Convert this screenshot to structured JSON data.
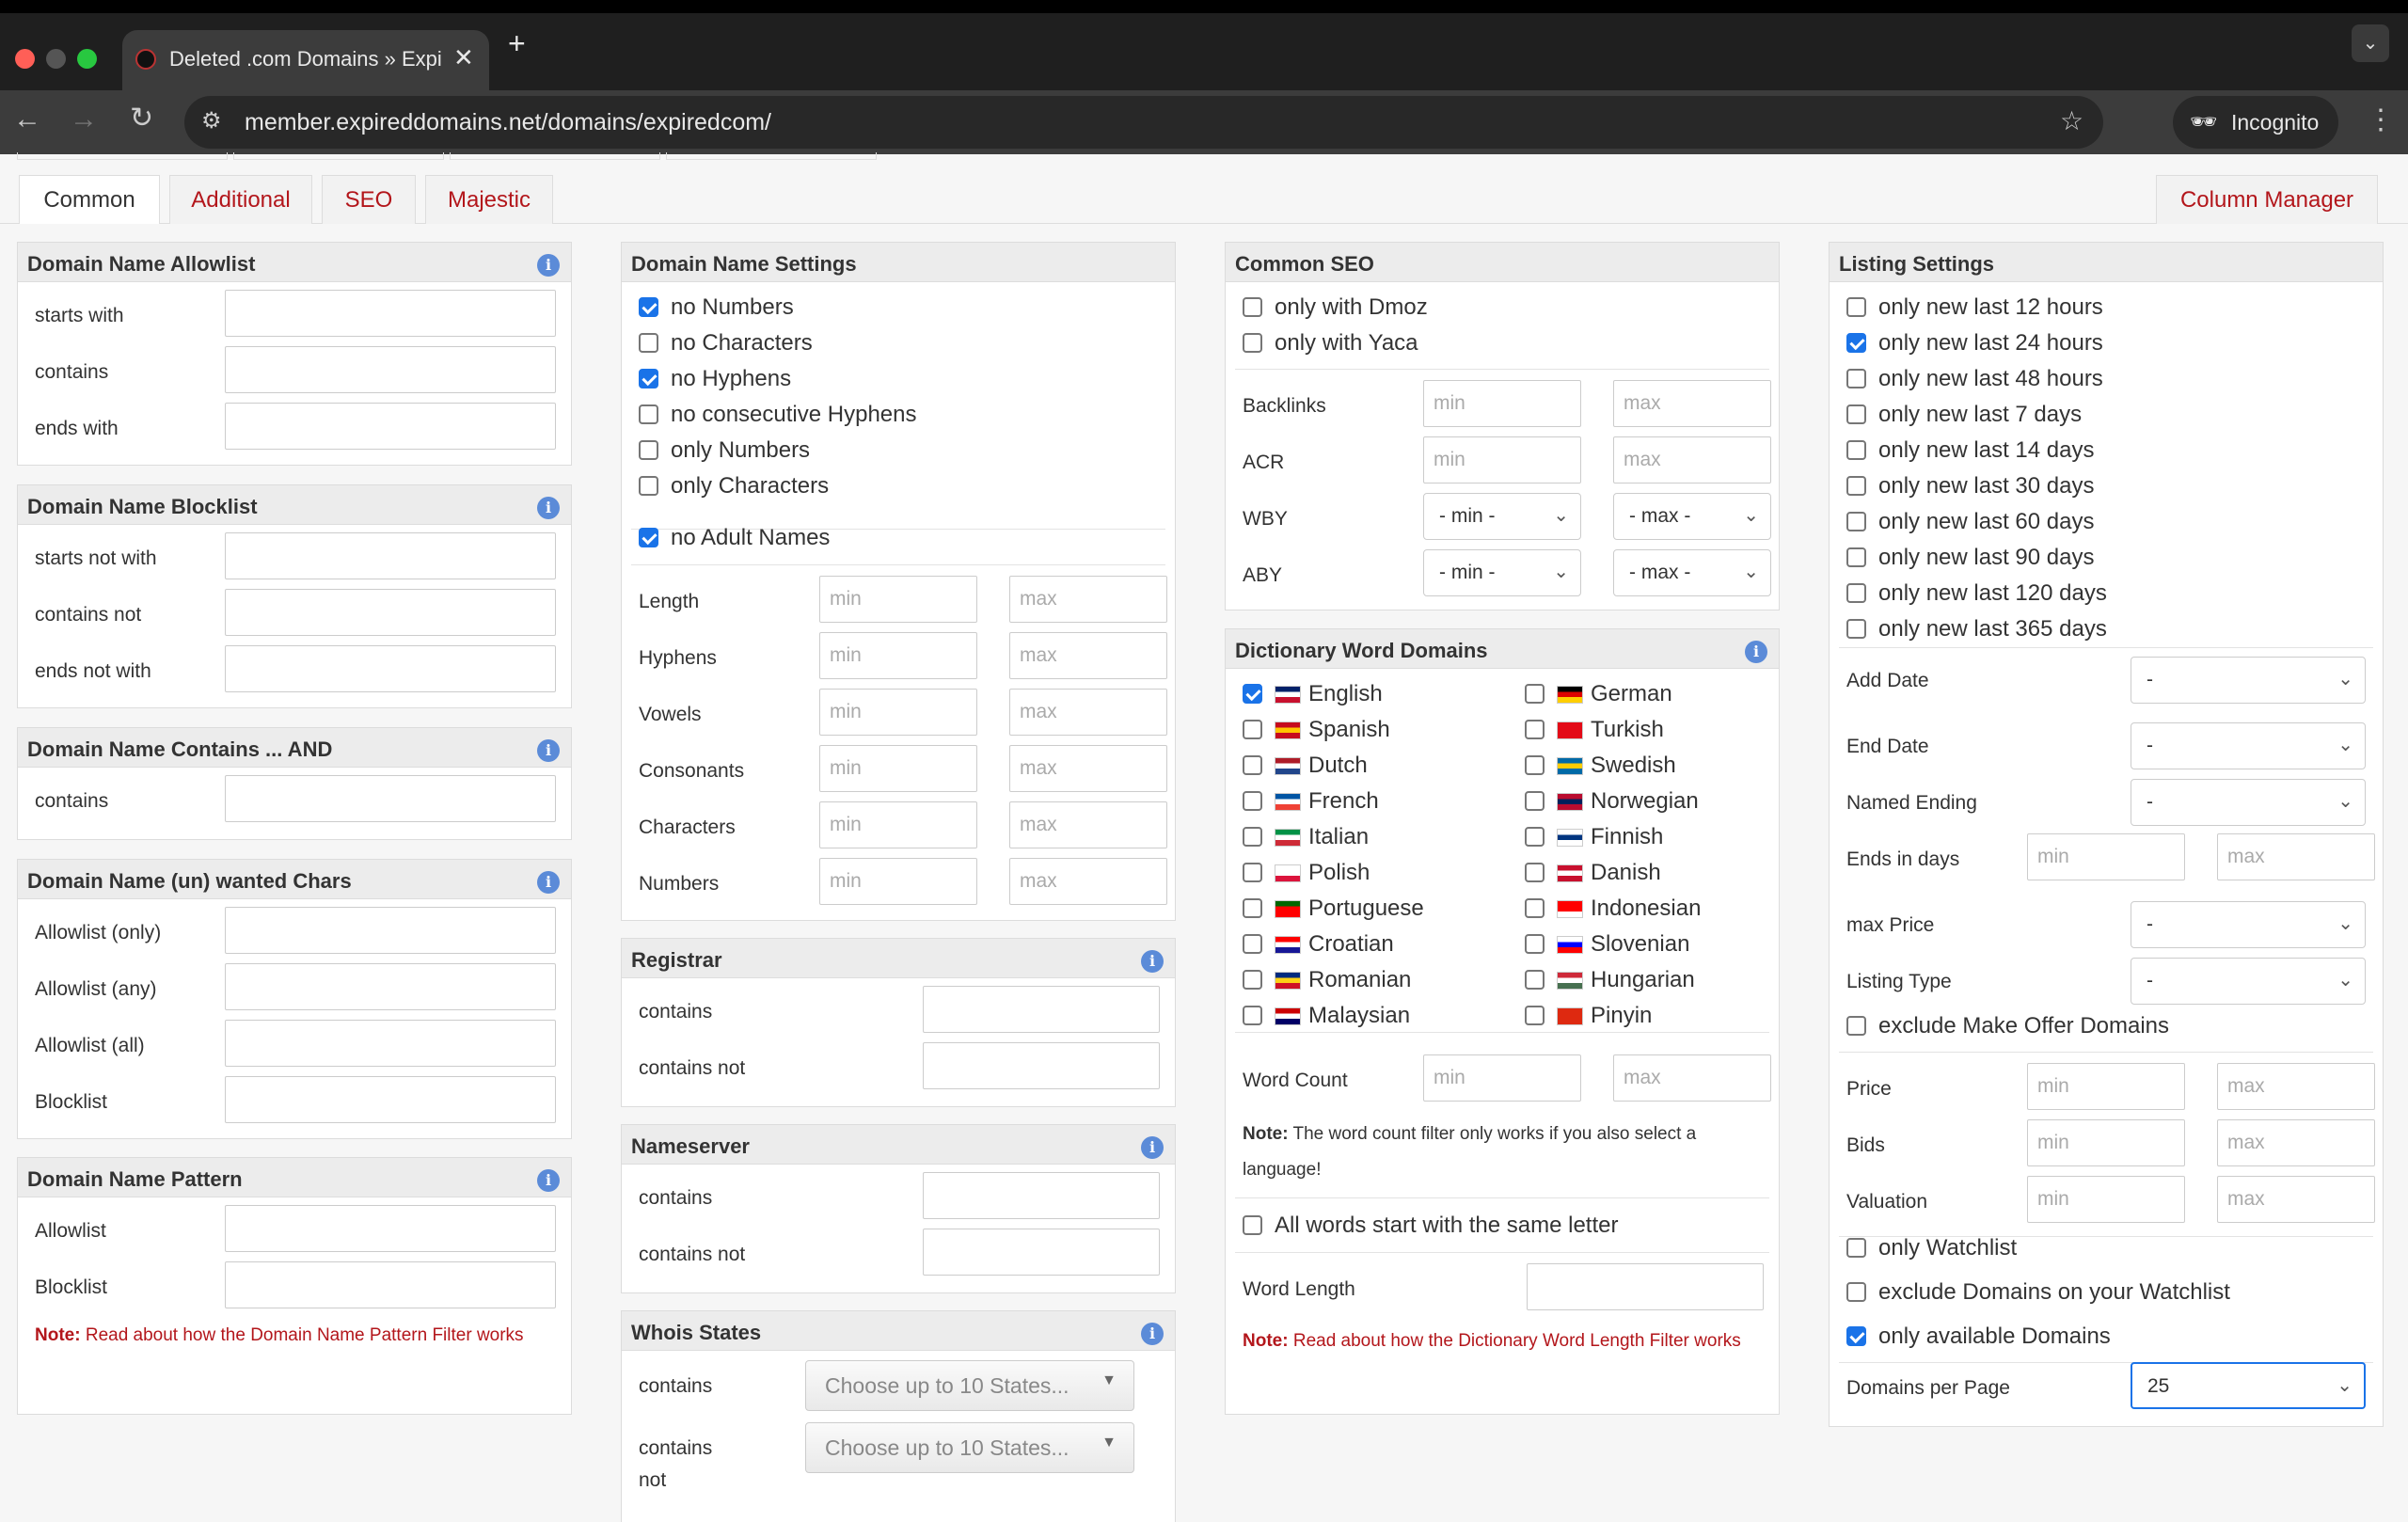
{
  "browser": {
    "tab_title": "Deleted .com Domains » Expi",
    "url": "member.expireddomains.net/domains/expiredcom/",
    "incognito_label": "Incognito"
  },
  "tabs": [
    {
      "label": "Common"
    },
    {
      "label": "Additional"
    },
    {
      "label": "SEO"
    },
    {
      "label": "Majestic"
    }
  ],
  "column_manager": "Column Manager",
  "placeholders": {
    "min": "min",
    "max": "max",
    "minsel": "- min -",
    "maxsel": "- max -",
    "dash": "-",
    "states": "Choose up to 10 States..."
  },
  "allowlist": {
    "title": "Domain Name Allowlist",
    "rows": [
      "starts with",
      "contains",
      "ends with"
    ]
  },
  "blocklist": {
    "title": "Domain Name Blocklist",
    "rows": [
      "starts not with",
      "contains not",
      "ends not with"
    ]
  },
  "contains_and": {
    "title": "Domain Name Contains ... AND",
    "rows": [
      "contains"
    ]
  },
  "wanted_chars": {
    "title": "Domain Name (un) wanted Chars",
    "rows": [
      "Allowlist (only)",
      "Allowlist (any)",
      "Allowlist (all)",
      "Blocklist"
    ]
  },
  "pattern": {
    "title": "Domain Name Pattern",
    "rows": [
      "Allowlist",
      "Blocklist"
    ],
    "note_label": "Note:",
    "note_text": "Read about how the Domain Name Pattern Filter works"
  },
  "settings": {
    "title": "Domain Name Settings",
    "checks": [
      {
        "label": "no Numbers",
        "checked": true
      },
      {
        "label": "no Characters",
        "checked": false
      },
      {
        "label": "no Hyphens",
        "checked": true
      },
      {
        "label": "no consecutive Hyphens",
        "checked": false
      },
      {
        "label": "only Numbers",
        "checked": false
      },
      {
        "label": "only Characters",
        "checked": false
      }
    ],
    "adult": {
      "label": "no Adult Names",
      "checked": true
    },
    "ranges": [
      "Length",
      "Hyphens",
      "Vowels",
      "Consonants",
      "Characters",
      "Numbers"
    ]
  },
  "registrar": {
    "title": "Registrar",
    "rows": [
      "contains",
      "contains not"
    ]
  },
  "nameserver": {
    "title": "Nameserver",
    "rows": [
      "contains",
      "contains not"
    ]
  },
  "whois": {
    "title": "Whois States",
    "rows": [
      "contains",
      "contains",
      "not"
    ]
  },
  "seo": {
    "title": "Common SEO",
    "checks": [
      "only with Dmoz",
      "only with Yaca"
    ],
    "rows": [
      "Backlinks",
      "ACR",
      "WBY",
      "ABY"
    ]
  },
  "dict": {
    "title": "Dictionary Word Domains",
    "left": [
      {
        "label": "English",
        "checked": true
      },
      {
        "label": "Spanish"
      },
      {
        "label": "Dutch"
      },
      {
        "label": "French"
      },
      {
        "label": "Italian"
      },
      {
        "label": "Polish"
      },
      {
        "label": "Portuguese"
      },
      {
        "label": "Croatian"
      },
      {
        "label": "Romanian"
      },
      {
        "label": "Malaysian"
      }
    ],
    "right": [
      {
        "label": "German"
      },
      {
        "label": "Turkish"
      },
      {
        "label": "Swedish"
      },
      {
        "label": "Norwegian"
      },
      {
        "label": "Finnish"
      },
      {
        "label": "Danish"
      },
      {
        "label": "Indonesian"
      },
      {
        "label": "Slovenian"
      },
      {
        "label": "Hungarian"
      },
      {
        "label": "Pinyin"
      }
    ],
    "word_count": "Word Count",
    "note_label": "Note:",
    "note_text": "The word count filter only works if you also select a language!",
    "same_letter": "All words start with the same letter",
    "word_length": "Word Length",
    "note2_label": "Note:",
    "note2_text": "Read about how the Dictionary Word Length Filter works"
  },
  "listing": {
    "title": "Listing Settings",
    "checks": [
      {
        "label": "only new last 12 hours",
        "checked": false
      },
      {
        "label": "only new last 24 hours",
        "checked": true
      },
      {
        "label": "only new last 48 hours",
        "checked": false
      },
      {
        "label": "only new last 7 days",
        "checked": false
      },
      {
        "label": "only new last 14 days",
        "checked": false
      },
      {
        "label": "only new last 30 days",
        "checked": false
      },
      {
        "label": "only new last 60 days",
        "checked": false
      },
      {
        "label": "only new last 90 days",
        "checked": false
      },
      {
        "label": "only new last 120 days",
        "checked": false
      },
      {
        "label": "only new last 365 days",
        "checked": false
      }
    ],
    "add_date": "Add Date",
    "end_date": "End Date",
    "named_ending": "Named Ending",
    "ends_in_days": "Ends in days",
    "max_price": "max Price",
    "listing_type": "Listing Type",
    "exclude_offer": "exclude Make Offer Domains",
    "price": "Price",
    "bids": "Bids",
    "valuation": "Valuation",
    "only_watchlist": "only Watchlist",
    "exclude_watchlist": "exclude Domains on your Watchlist",
    "only_available": "only available Domains",
    "per_page": "Domains per Page",
    "per_page_value": "25"
  }
}
